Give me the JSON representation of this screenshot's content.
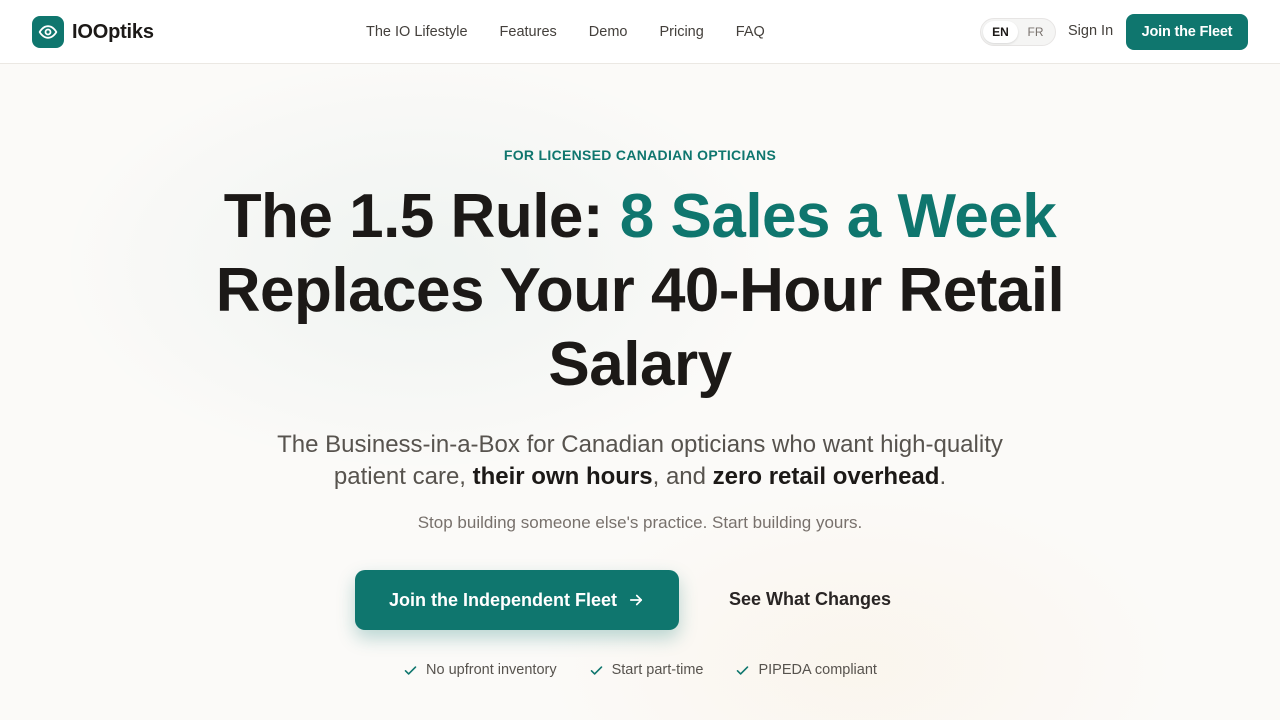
{
  "brand": {
    "name": "IOOptiks",
    "logo_icon": "eye-icon"
  },
  "nav": {
    "items": [
      "The IO Lifestyle",
      "Features",
      "Demo",
      "Pricing",
      "FAQ"
    ]
  },
  "language": {
    "options": [
      "EN",
      "FR"
    ],
    "selected": "EN"
  },
  "header_actions": {
    "sign_in": "Sign In",
    "join": "Join the Fleet"
  },
  "hero": {
    "eyebrow": "FOR LICENSED CANADIAN OPTICIANS",
    "title_prefix": "The 1.5 Rule: ",
    "title_accent": "8 Sales a Week",
    "title_suffix": "Replaces Your 40-Hour Retail Salary",
    "subtitle_part1": "The Business-in-a-Box for Canadian opticians who want high-quality patient care, ",
    "subtitle_bold1": "their own hours",
    "subtitle_part2": ", and ",
    "subtitle_bold2": "zero retail overhead",
    "subtitle_part3": ".",
    "tagline": "Stop building someone else's practice. Start building yours.",
    "cta_primary": "Join the Independent Fleet",
    "cta_secondary": "See What Changes",
    "checks": [
      "No upfront inventory",
      "Start part-time",
      "PIPEDA compliant"
    ]
  },
  "colors": {
    "accent": "#0f766e",
    "text": "#1c1917",
    "muted": "#78716c"
  }
}
